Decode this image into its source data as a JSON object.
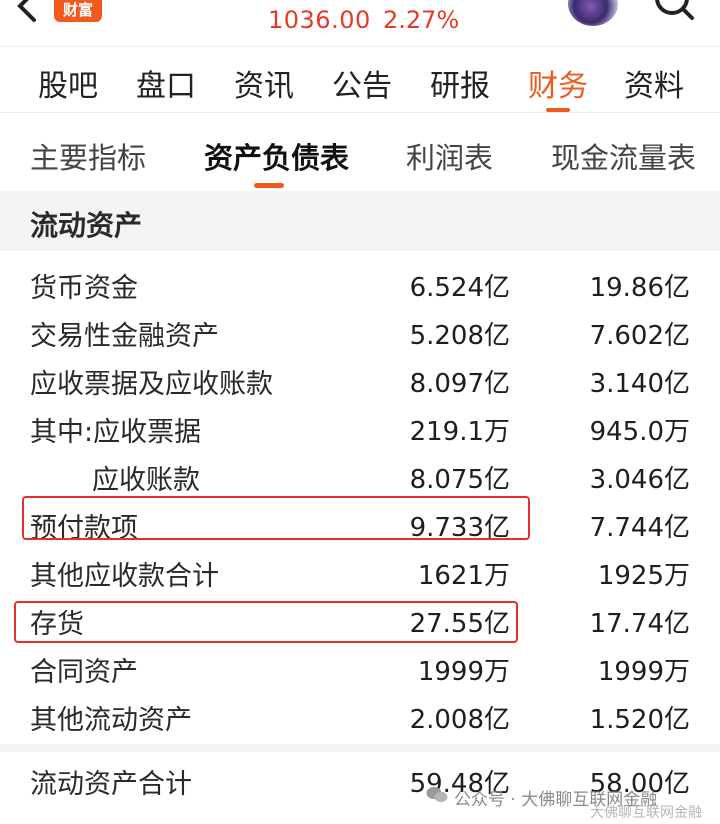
{
  "header": {
    "brand_badge": "财富",
    "price": "1036.00",
    "change_pct": "2.27%"
  },
  "main_tabs": [
    {
      "label": "股吧",
      "active": false
    },
    {
      "label": "盘口",
      "active": false
    },
    {
      "label": "资讯",
      "active": false
    },
    {
      "label": "公告",
      "active": false
    },
    {
      "label": "研报",
      "active": false
    },
    {
      "label": "财务",
      "active": true
    },
    {
      "label": "资料",
      "active": false
    }
  ],
  "sub_tabs": [
    {
      "label": "主要指标",
      "active": false
    },
    {
      "label": "资产负债表",
      "active": true
    },
    {
      "label": "利润表",
      "active": false
    },
    {
      "label": "现金流量表",
      "active": false
    }
  ],
  "section": {
    "title": "流动资产"
  },
  "rows": [
    {
      "label": "货币资金",
      "v1": "6.524亿",
      "v2": "19.86亿"
    },
    {
      "label": "交易性金融资产",
      "v1": "5.208亿",
      "v2": "7.602亿"
    },
    {
      "label": "应收票据及应收账款",
      "v1": "8.097亿",
      "v2": "3.140亿"
    },
    {
      "label": "其中:应收票据",
      "v1": "219.1万",
      "v2": "945.0万"
    },
    {
      "label": "应收账款",
      "v1": "8.075亿",
      "v2": "3.046亿"
    },
    {
      "label": "预付款项",
      "v1": "9.733亿",
      "v2": "7.744亿"
    },
    {
      "label": "其他应收款合计",
      "v1": "1621万",
      "v2": "1925万"
    },
    {
      "label": "存货",
      "v1": "27.55亿",
      "v2": "17.74亿"
    },
    {
      "label": "合同资产",
      "v1": "1999万",
      "v2": "1999万"
    },
    {
      "label": "其他流动资产",
      "v1": "2.008亿",
      "v2": "1.520亿"
    }
  ],
  "total": {
    "label": "流动资产合计",
    "v1": "59.48亿",
    "v2": "58.00亿"
  },
  "watermark": {
    "text": "公众号 · 大佛聊互联网金融",
    "text2": "大佛聊互联网金融"
  },
  "colors": {
    "accent": "#f15a1f",
    "price_red": "#e53a2b",
    "highlight_red": "#e53030"
  },
  "icons": [
    "back-arrow-icon",
    "avatar",
    "search-icon",
    "wechat-icon"
  ]
}
